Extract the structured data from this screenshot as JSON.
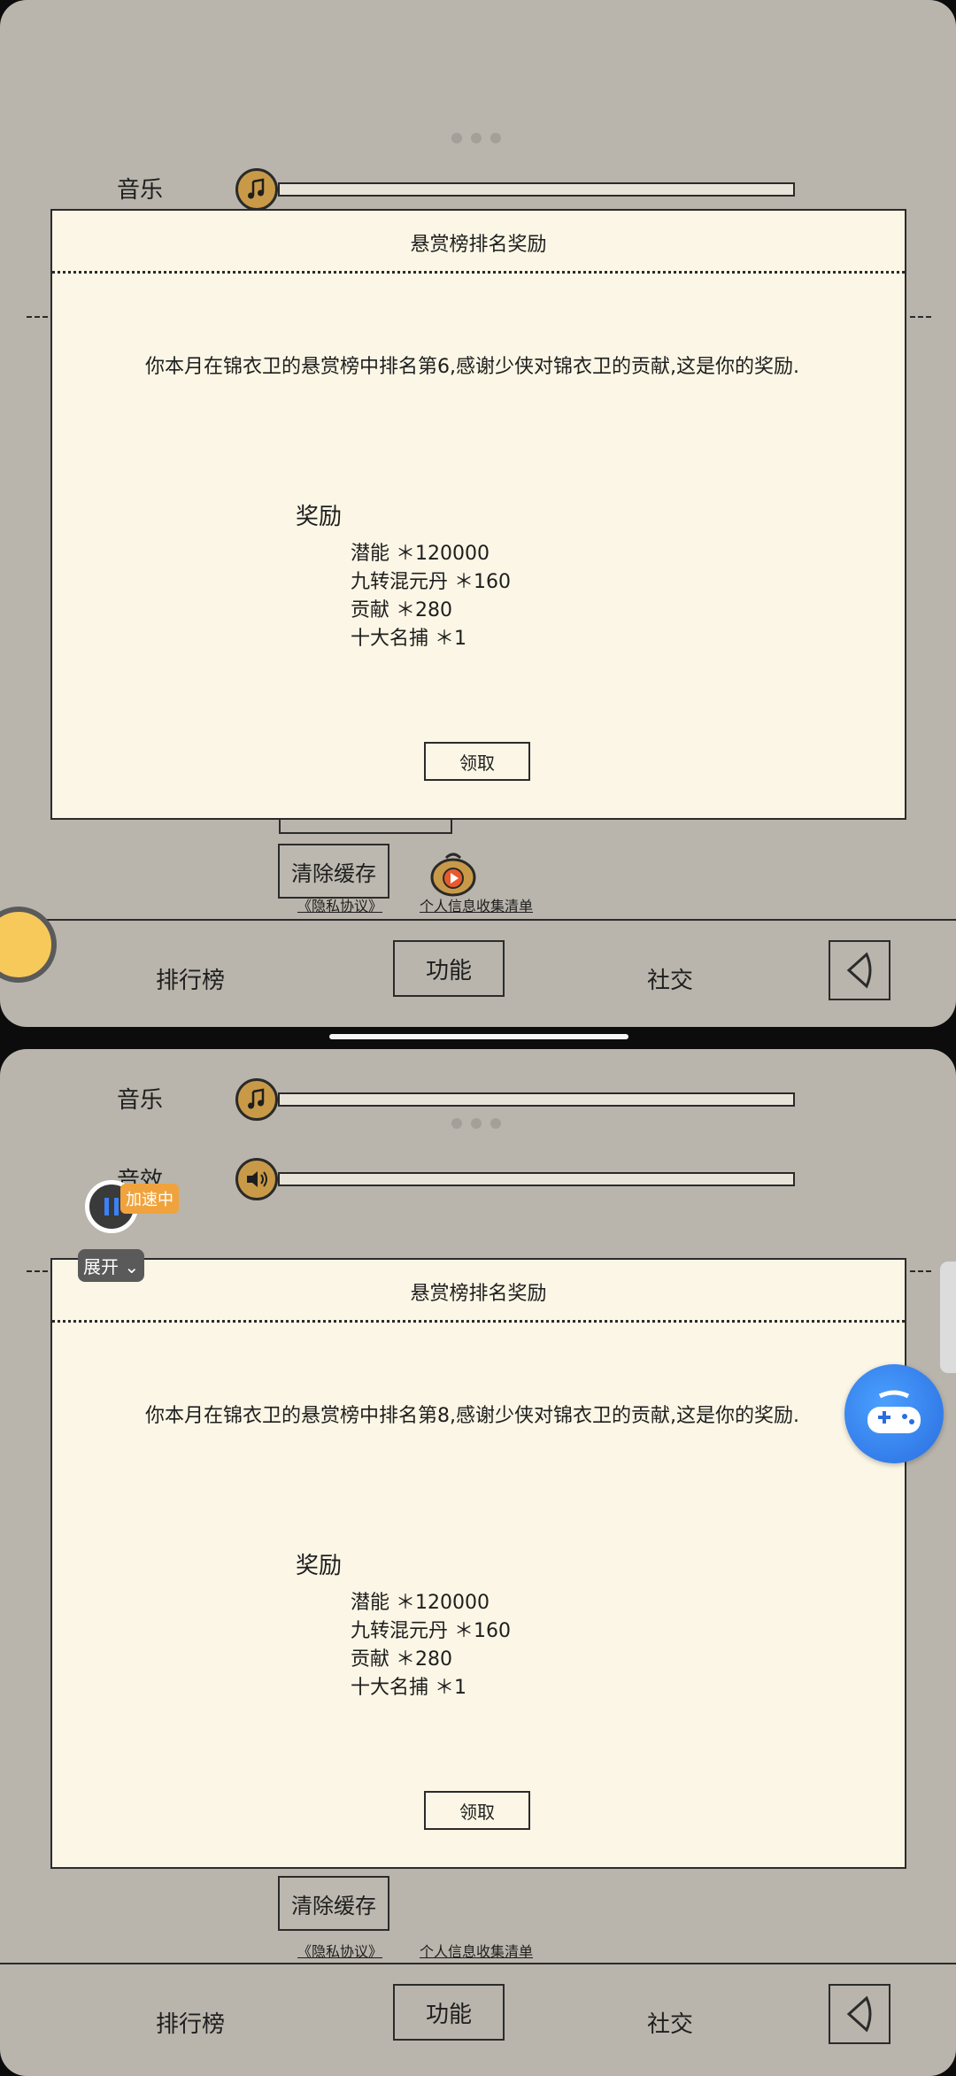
{
  "settings": {
    "music_label": "音乐",
    "sound_label": "音效"
  },
  "dialog_top": {
    "title": "悬赏榜排名奖励",
    "message": "你本月在锦衣卫的悬赏榜中排名第6,感谢少侠对锦衣卫的贡献,这是你的奖励.",
    "reward_heading": "奖励",
    "rewards": [
      "潜能 ＊120000",
      "九转混元丹 ＊160",
      "贡献 ＊280",
      "十大名捕 ＊1"
    ],
    "claim_label": "领取"
  },
  "dialog_bottom": {
    "title": "悬赏榜排名奖励",
    "message": "你本月在锦衣卫的悬赏榜中排名第8,感谢少侠对锦衣卫的贡献,这是你的奖励.",
    "reward_heading": "奖励",
    "rewards": [
      "潜能 ＊120000",
      "九转混元丹 ＊160",
      "贡献 ＊280",
      "十大名捕 ＊1"
    ],
    "claim_label": "领取"
  },
  "actions": {
    "clear_cache": "清除缓存",
    "privacy": "《隐私协议》",
    "info_list": "个人信息收集清单"
  },
  "nav": {
    "ranking": "排行榜",
    "function": "功能",
    "social": "社交"
  },
  "overlay": {
    "speed_badge": "加速中",
    "expand_label": "展开"
  },
  "colors": {
    "background": "#b9b5ac",
    "dialog": "#fbf6e5",
    "icon_gold": "#c89a48",
    "speed_badge": "#f0a33c"
  }
}
